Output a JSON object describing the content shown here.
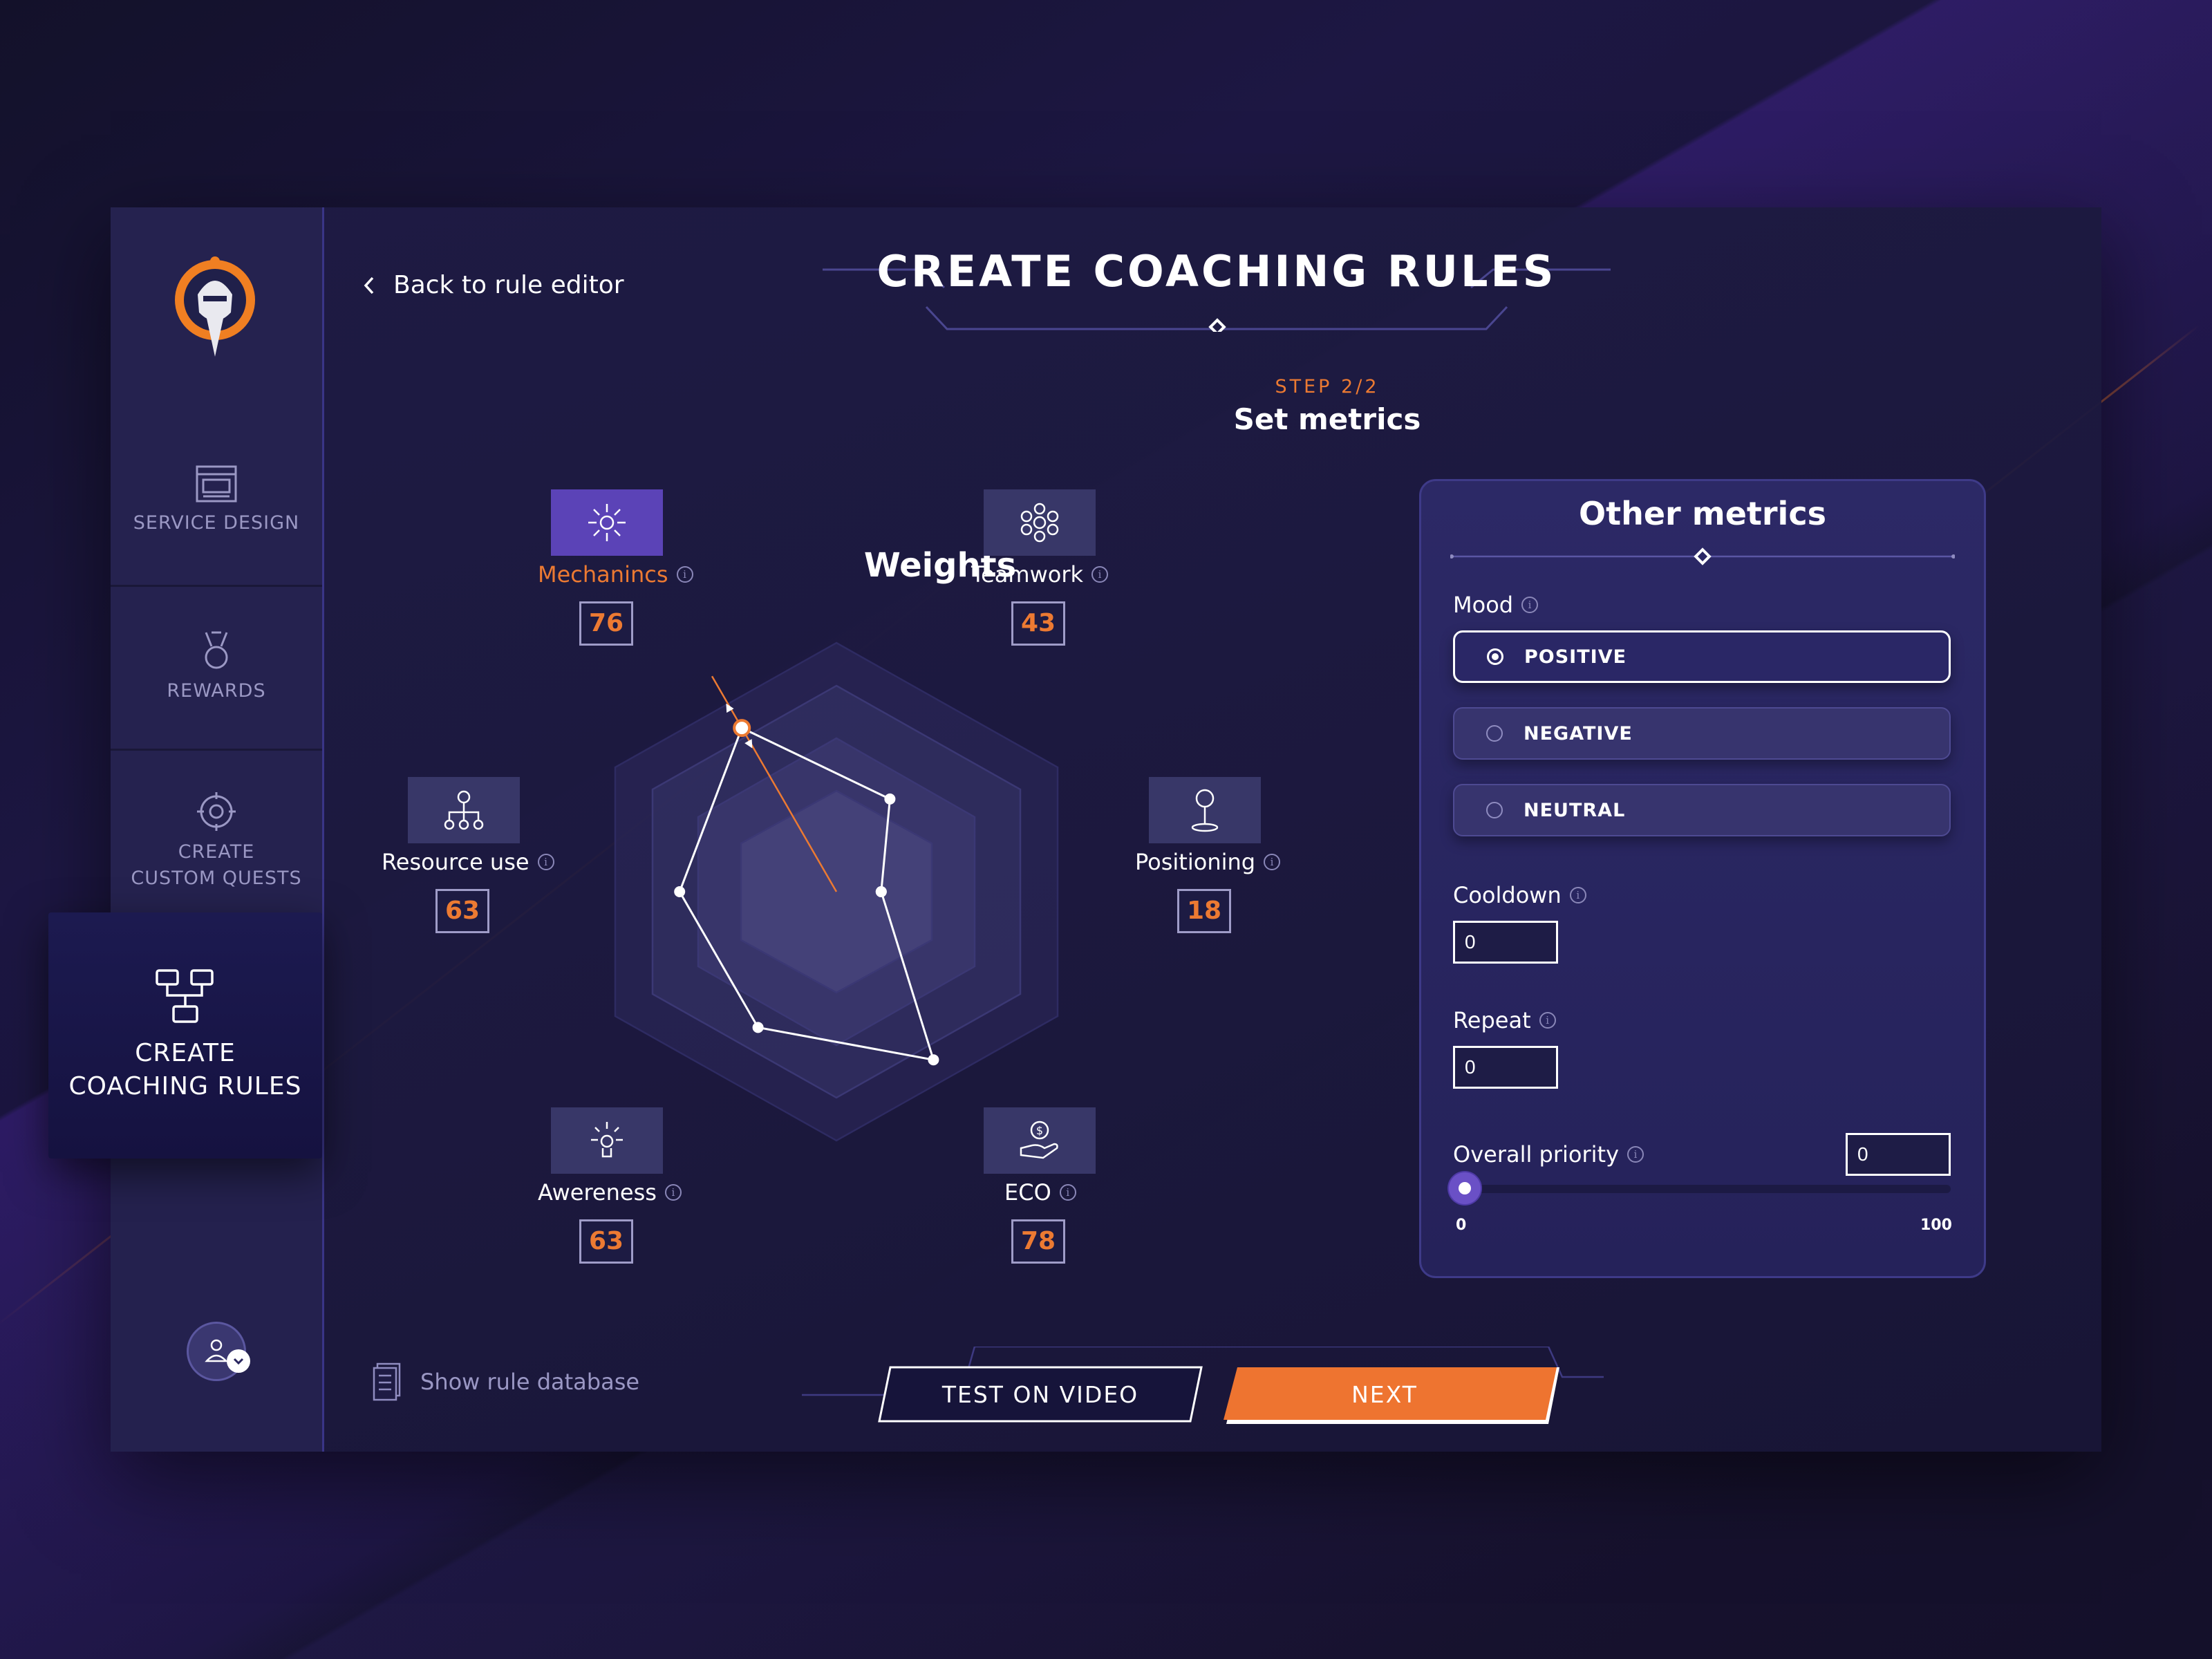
{
  "sidebar": {
    "items": [
      {
        "label": "SERVICE DESIGN",
        "icon": "browser-window-icon"
      },
      {
        "label": "REWARDS",
        "icon": "medal-icon"
      },
      {
        "label_line1": "CREATE",
        "label_line2": "CUSTOM QUESTS",
        "icon": "target-icon"
      }
    ],
    "active": {
      "label_line1": "CREATE",
      "label_line2": "COACHING RULES",
      "icon": "flowchart-icon"
    }
  },
  "header": {
    "back_label": "Back to rule editor",
    "title": "CREATE COACHING RULES",
    "step": "STEP 2/2",
    "step_title": "Set metrics"
  },
  "weights": {
    "title": "Weights",
    "metrics": [
      {
        "name": "Mechanincs",
        "value": "76",
        "active": true
      },
      {
        "name": "Teamwork",
        "value": "43",
        "active": false
      },
      {
        "name": "Positioning",
        "value": "18",
        "active": false
      },
      {
        "name": "ECO",
        "value": "78",
        "active": false
      },
      {
        "name": "Awereness",
        "value": "63",
        "active": false
      },
      {
        "name": "Resource use",
        "value": "63",
        "active": false
      }
    ]
  },
  "other_metrics": {
    "title": "Other metrics",
    "mood_label": "Mood",
    "mood_options": [
      "POSITIVE",
      "NEGATIVE",
      "NEUTRAL"
    ],
    "mood_selected": "POSITIVE",
    "cooldown_label": "Cooldown",
    "cooldown_value": "0",
    "repeat_label": "Repeat",
    "repeat_value": "0",
    "priority_label": "Overall priority",
    "priority_value": "0",
    "slider_min": "0",
    "slider_max": "100",
    "slider_level": 0
  },
  "footer": {
    "rule_db_label": "Show rule database",
    "test_label": "TEST ON VIDEO",
    "next_label": "NEXT"
  },
  "colors": {
    "accent": "#ec7a32",
    "active_tile": "#5b43b7",
    "panel_border": "#3e3a88"
  }
}
